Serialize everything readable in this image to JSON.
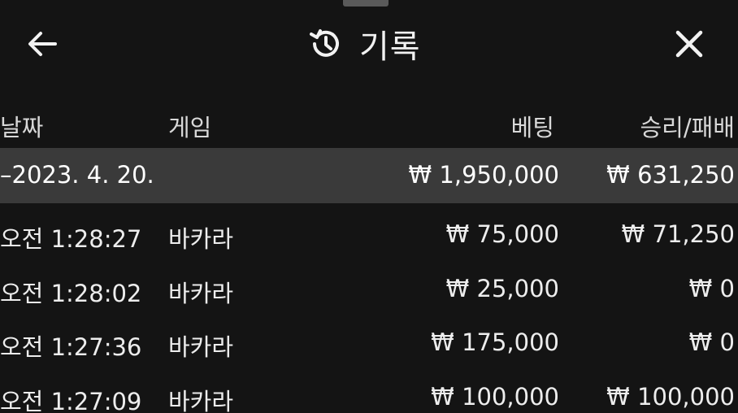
{
  "header": {
    "back_icon": "arrow-left-icon",
    "history_icon": "history-clock-icon",
    "title": "기록",
    "close_icon": "close-x-icon"
  },
  "columns": {
    "date": "날짜",
    "game": "게임",
    "bet": "베팅",
    "win_loss": "승리/패배"
  },
  "group": {
    "date": "–2023. 4. 20.",
    "total_bet": "₩ 1,950,000",
    "total_win_loss": "₩ 631,250"
  },
  "rows": [
    {
      "time": "오전 1:28:27",
      "game": "바카라",
      "bet": "₩ 75,000",
      "win_loss": "₩ 71,250"
    },
    {
      "time": "오전 1:28:02",
      "game": "바카라",
      "bet": "₩ 25,000",
      "win_loss": "₩ 0"
    },
    {
      "time": "오전 1:27:36",
      "game": "바카라",
      "bet": "₩ 175,000",
      "win_loss": "₩ 0"
    },
    {
      "time": "오전 1:27:09",
      "game": "바카라",
      "bet": "₩ 100,000",
      "win_loss": "₩ 100,000"
    }
  ],
  "colors": {
    "background": "#141414",
    "group_row": "#3a3a3a",
    "text": "#ececec"
  }
}
